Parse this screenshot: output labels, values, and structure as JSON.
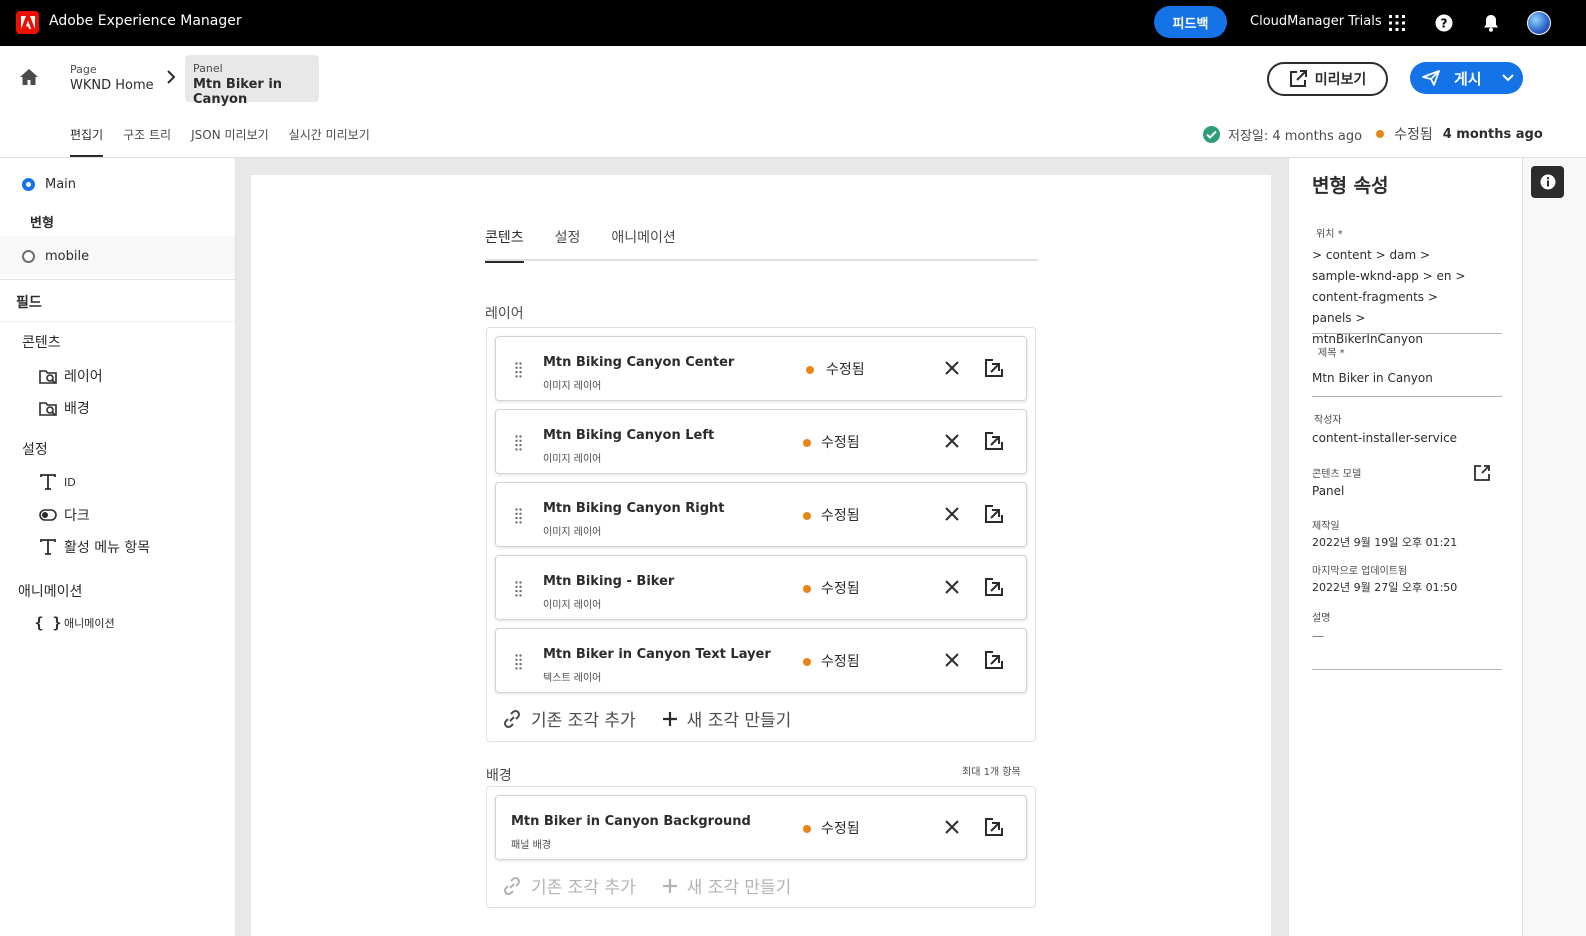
{
  "topbar": {
    "app_title": "Adobe Experience Manager",
    "feedback_label": "피드백",
    "org_name": "CloudManager Trials",
    "icons": [
      "apps-grid-icon",
      "help-icon",
      "bell-icon",
      "avatar"
    ]
  },
  "header": {
    "breadcrumb": [
      {
        "type": "Page",
        "title": "WKND Home"
      },
      {
        "type": "Panel",
        "title": "Mtn Biker in Canyon"
      }
    ],
    "preview_label": "미리보기",
    "publish_label": "게시",
    "tabs": [
      "편집기",
      "구조 트리",
      "JSON 미리보기",
      "실시간 미리보기"
    ],
    "active_tab": "편집기",
    "status": {
      "saved_text": "저장일: 4 months ago",
      "modified_label": "수정됨",
      "modified_ago": "4 months ago"
    }
  },
  "sidebar": {
    "variations": [
      {
        "label": "Main",
        "selected": true
      },
      {
        "label": "mobile",
        "selected": false
      }
    ],
    "variations_heading": "변형",
    "fields_heading": "필드",
    "groups": [
      {
        "title": "콘텐츠",
        "items": [
          {
            "label": "레이어",
            "icon": "fragment-search-icon"
          },
          {
            "label": "배경",
            "icon": "fragment-search-icon"
          }
        ]
      },
      {
        "title": "설정",
        "items": [
          {
            "label": "ID",
            "icon": "text-field-icon"
          },
          {
            "label": "다크",
            "icon": "toggle-icon"
          },
          {
            "label": "활성 메뉴 항목",
            "icon": "text-field-icon"
          }
        ]
      },
      {
        "title": "애니메이션",
        "items": [
          {
            "label": "애니메이션",
            "icon": "json-braces-icon"
          }
        ]
      }
    ]
  },
  "editor": {
    "tabs": [
      "콘텐츠",
      "설정",
      "애니메이션"
    ],
    "active_tab": "콘텐츠",
    "layers": {
      "label": "레이어",
      "items": [
        {
          "title": "Mtn Biking Canyon Center",
          "type": "이미지 레이어",
          "status": "수정됨"
        },
        {
          "title": "Mtn Biking Canyon Left",
          "type": "이미지 레이어",
          "status": "수정됨"
        },
        {
          "title": "Mtn Biking Canyon Right",
          "type": "이미지 레이어",
          "status": "수정됨"
        },
        {
          "title": "Mtn Biking - Biker",
          "type": "이미지 레이어",
          "status": "수정됨"
        },
        {
          "title": "Mtn Biker in Canyon Text Layer",
          "type": "텍스트 레이어",
          "status": "수정됨"
        }
      ],
      "add_existing": "기존 조각 추가",
      "create_new": "새 조각 만들기"
    },
    "background": {
      "label": "배경",
      "max_note": "최대 1개 항목",
      "items": [
        {
          "title": "Mtn Biker in Canyon Background",
          "type": "패널 배경",
          "status": "수정됨"
        }
      ],
      "add_existing": "기존 조각 추가",
      "create_new": "새 조각 만들기"
    }
  },
  "properties": {
    "title": "변형 속성",
    "location_label": "위치 *",
    "location_value": " > content > dam > sample-wknd-app > en > content-fragments > panels > mtnBikerInCanyon",
    "title_label": "제목 *",
    "title_value": "Mtn Biker in Canyon",
    "author_label": "작성자",
    "author_value": "content-installer-service",
    "model_label": "콘텐츠 모델",
    "model_value": "Panel",
    "created_label": "제작일",
    "created_value": "2022년 9월 19일 오후 01:21",
    "updated_label": "마지막으로 업데이트됨",
    "updated_value": "2022년 9월 27일 오후 01:50",
    "description_label": "설명",
    "description_value": "—"
  },
  "colors": {
    "accent": "#1473e6",
    "modified_dot": "#e68619",
    "saved_check": "#2d9d78",
    "adobe_red": "#eb1000"
  }
}
